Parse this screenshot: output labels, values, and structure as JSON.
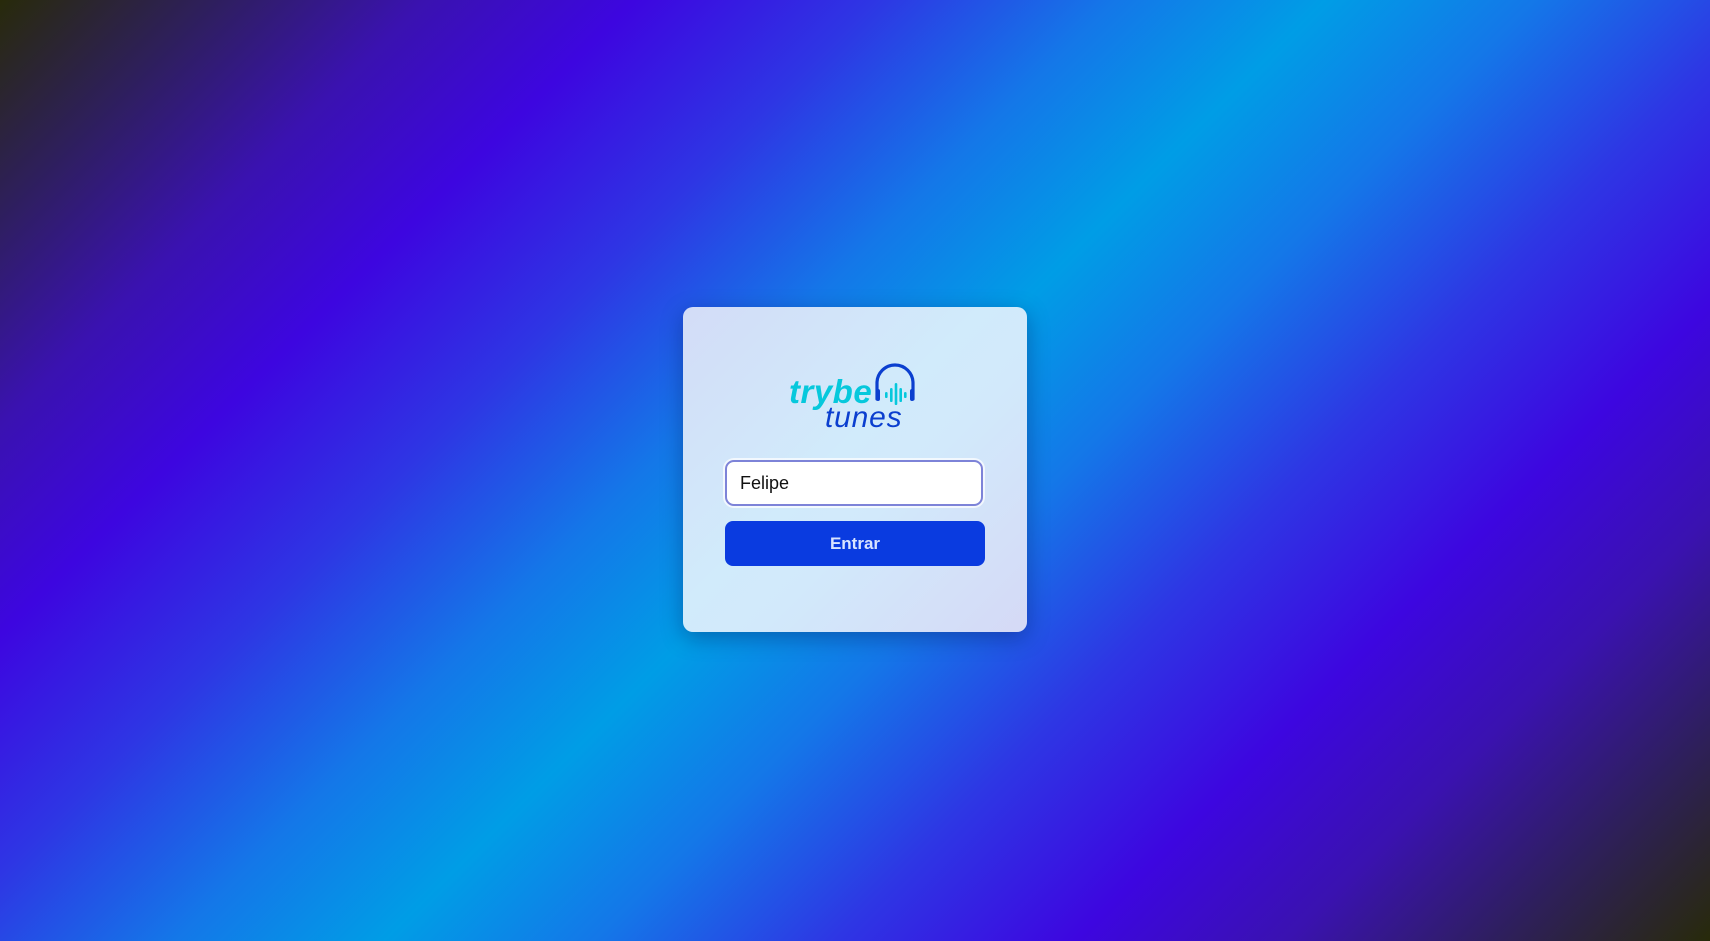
{
  "logo": {
    "word_top": "trybe",
    "word_bottom": "tunes",
    "icon": "headphones-soundwave-icon"
  },
  "login": {
    "name_value": "Felipe",
    "submit_label": "Entrar"
  },
  "colors": {
    "brand_cyan": "#06c8dc",
    "brand_blue": "#0b3fcf",
    "button_bg": "#0a3be0",
    "input_border": "#7d83d8"
  }
}
